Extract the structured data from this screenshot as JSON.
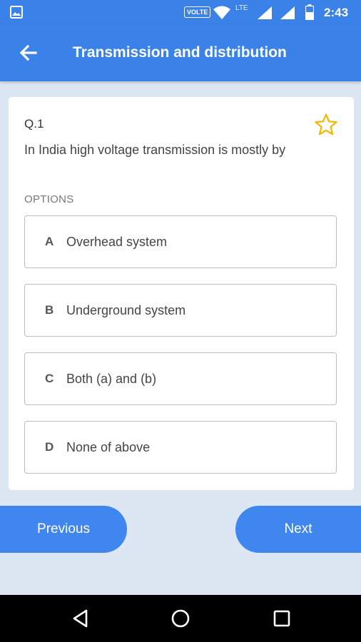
{
  "status_bar": {
    "time": "2:43",
    "volte": "VOLTE",
    "network": "LTE",
    "icons": [
      "image-icon",
      "wifi-icon",
      "signal-icon",
      "signal-icon",
      "battery-icon"
    ]
  },
  "app_bar": {
    "title": "Transmission and distribution",
    "back_icon": "arrow-left-icon",
    "color": "#3a82e8"
  },
  "question": {
    "number": "Q.1",
    "text": "In India high voltage transmission is mostly by",
    "bookmark_icon": "star-outline-icon",
    "star_color": "#f5b400"
  },
  "options_heading": "OPTIONS",
  "options": [
    {
      "letter": "A",
      "text": "Overhead system"
    },
    {
      "letter": "B",
      "text": "Underground system"
    },
    {
      "letter": "C",
      "text": "Both (a) and (b)"
    },
    {
      "letter": "D",
      "text": "None of above"
    }
  ],
  "navigation": {
    "previous_label": "Previous",
    "next_label": "Next",
    "button_color": "#3f87ee"
  },
  "system_nav": {
    "icons": [
      "back-triangle-icon",
      "home-circle-icon",
      "recents-square-icon"
    ]
  }
}
